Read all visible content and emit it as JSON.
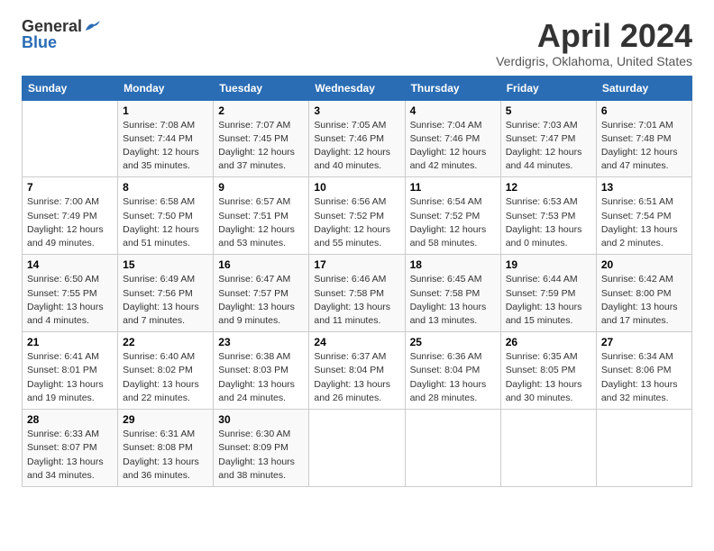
{
  "header": {
    "logo_general": "General",
    "logo_blue": "Blue",
    "month_title": "April 2024",
    "location": "Verdigris, Oklahoma, United States"
  },
  "days_of_week": [
    "Sunday",
    "Monday",
    "Tuesday",
    "Wednesday",
    "Thursday",
    "Friday",
    "Saturday"
  ],
  "weeks": [
    [
      {
        "day": "",
        "info": ""
      },
      {
        "day": "1",
        "info": "Sunrise: 7:08 AM\nSunset: 7:44 PM\nDaylight: 12 hours\nand 35 minutes."
      },
      {
        "day": "2",
        "info": "Sunrise: 7:07 AM\nSunset: 7:45 PM\nDaylight: 12 hours\nand 37 minutes."
      },
      {
        "day": "3",
        "info": "Sunrise: 7:05 AM\nSunset: 7:46 PM\nDaylight: 12 hours\nand 40 minutes."
      },
      {
        "day": "4",
        "info": "Sunrise: 7:04 AM\nSunset: 7:46 PM\nDaylight: 12 hours\nand 42 minutes."
      },
      {
        "day": "5",
        "info": "Sunrise: 7:03 AM\nSunset: 7:47 PM\nDaylight: 12 hours\nand 44 minutes."
      },
      {
        "day": "6",
        "info": "Sunrise: 7:01 AM\nSunset: 7:48 PM\nDaylight: 12 hours\nand 47 minutes."
      }
    ],
    [
      {
        "day": "7",
        "info": "Sunrise: 7:00 AM\nSunset: 7:49 PM\nDaylight: 12 hours\nand 49 minutes."
      },
      {
        "day": "8",
        "info": "Sunrise: 6:58 AM\nSunset: 7:50 PM\nDaylight: 12 hours\nand 51 minutes."
      },
      {
        "day": "9",
        "info": "Sunrise: 6:57 AM\nSunset: 7:51 PM\nDaylight: 12 hours\nand 53 minutes."
      },
      {
        "day": "10",
        "info": "Sunrise: 6:56 AM\nSunset: 7:52 PM\nDaylight: 12 hours\nand 55 minutes."
      },
      {
        "day": "11",
        "info": "Sunrise: 6:54 AM\nSunset: 7:52 PM\nDaylight: 12 hours\nand 58 minutes."
      },
      {
        "day": "12",
        "info": "Sunrise: 6:53 AM\nSunset: 7:53 PM\nDaylight: 13 hours\nand 0 minutes."
      },
      {
        "day": "13",
        "info": "Sunrise: 6:51 AM\nSunset: 7:54 PM\nDaylight: 13 hours\nand 2 minutes."
      }
    ],
    [
      {
        "day": "14",
        "info": "Sunrise: 6:50 AM\nSunset: 7:55 PM\nDaylight: 13 hours\nand 4 minutes."
      },
      {
        "day": "15",
        "info": "Sunrise: 6:49 AM\nSunset: 7:56 PM\nDaylight: 13 hours\nand 7 minutes."
      },
      {
        "day": "16",
        "info": "Sunrise: 6:47 AM\nSunset: 7:57 PM\nDaylight: 13 hours\nand 9 minutes."
      },
      {
        "day": "17",
        "info": "Sunrise: 6:46 AM\nSunset: 7:58 PM\nDaylight: 13 hours\nand 11 minutes."
      },
      {
        "day": "18",
        "info": "Sunrise: 6:45 AM\nSunset: 7:58 PM\nDaylight: 13 hours\nand 13 minutes."
      },
      {
        "day": "19",
        "info": "Sunrise: 6:44 AM\nSunset: 7:59 PM\nDaylight: 13 hours\nand 15 minutes."
      },
      {
        "day": "20",
        "info": "Sunrise: 6:42 AM\nSunset: 8:00 PM\nDaylight: 13 hours\nand 17 minutes."
      }
    ],
    [
      {
        "day": "21",
        "info": "Sunrise: 6:41 AM\nSunset: 8:01 PM\nDaylight: 13 hours\nand 19 minutes."
      },
      {
        "day": "22",
        "info": "Sunrise: 6:40 AM\nSunset: 8:02 PM\nDaylight: 13 hours\nand 22 minutes."
      },
      {
        "day": "23",
        "info": "Sunrise: 6:38 AM\nSunset: 8:03 PM\nDaylight: 13 hours\nand 24 minutes."
      },
      {
        "day": "24",
        "info": "Sunrise: 6:37 AM\nSunset: 8:04 PM\nDaylight: 13 hours\nand 26 minutes."
      },
      {
        "day": "25",
        "info": "Sunrise: 6:36 AM\nSunset: 8:04 PM\nDaylight: 13 hours\nand 28 minutes."
      },
      {
        "day": "26",
        "info": "Sunrise: 6:35 AM\nSunset: 8:05 PM\nDaylight: 13 hours\nand 30 minutes."
      },
      {
        "day": "27",
        "info": "Sunrise: 6:34 AM\nSunset: 8:06 PM\nDaylight: 13 hours\nand 32 minutes."
      }
    ],
    [
      {
        "day": "28",
        "info": "Sunrise: 6:33 AM\nSunset: 8:07 PM\nDaylight: 13 hours\nand 34 minutes."
      },
      {
        "day": "29",
        "info": "Sunrise: 6:31 AM\nSunset: 8:08 PM\nDaylight: 13 hours\nand 36 minutes."
      },
      {
        "day": "30",
        "info": "Sunrise: 6:30 AM\nSunset: 8:09 PM\nDaylight: 13 hours\nand 38 minutes."
      },
      {
        "day": "",
        "info": ""
      },
      {
        "day": "",
        "info": ""
      },
      {
        "day": "",
        "info": ""
      },
      {
        "day": "",
        "info": ""
      }
    ]
  ]
}
